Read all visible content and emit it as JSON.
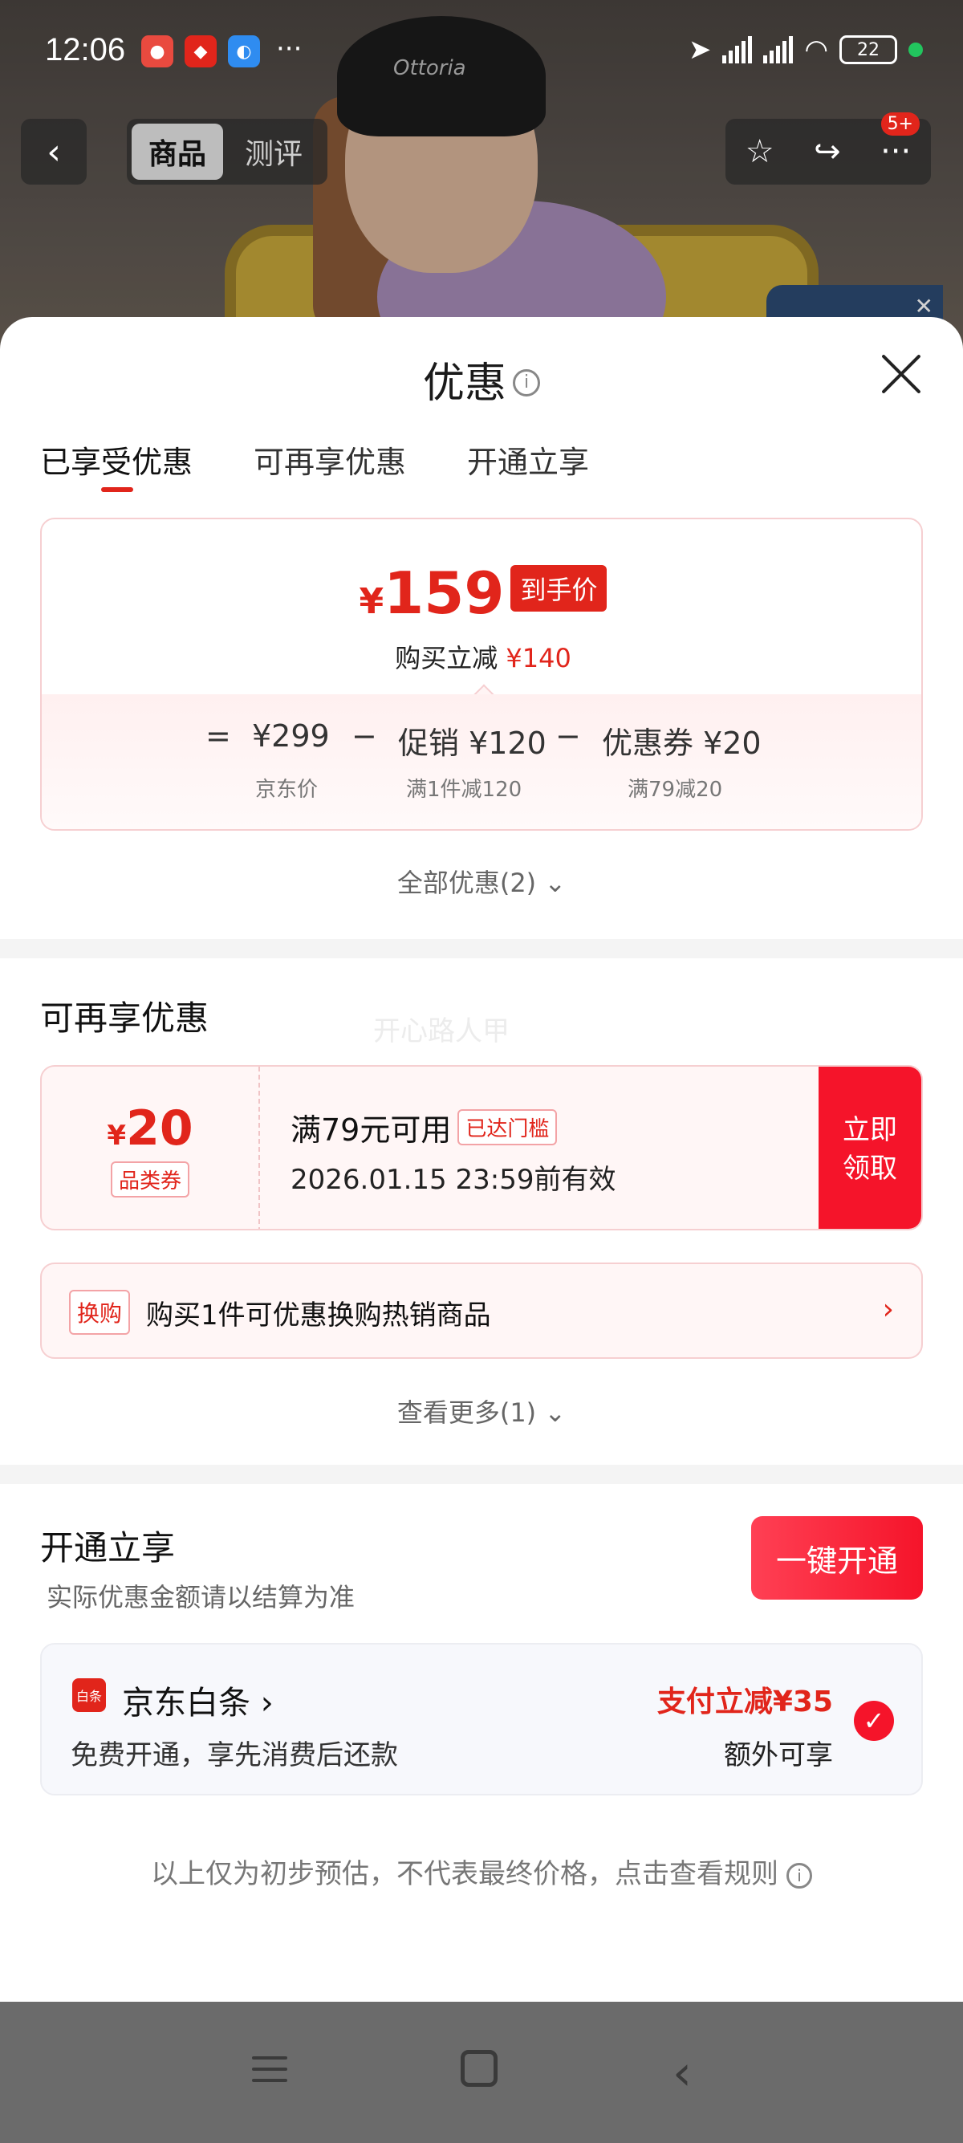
{
  "status_bar": {
    "time": "12:06",
    "battery": "22",
    "app_icons": [
      "app-icon-1",
      "app-icon-2",
      "app-icon-3"
    ],
    "more": "···"
  },
  "nav": {
    "back_glyph": "‹",
    "tabs": [
      "商品",
      "测评"
    ],
    "badge": "5+"
  },
  "sheet": {
    "title": "优惠",
    "tabs": [
      "已享受优惠",
      "可再享优惠",
      "开通立享"
    ],
    "price": {
      "currency": "¥",
      "final": "159",
      "final_tag": "到手价",
      "instant_label": "购买立减",
      "instant_amount": "¥140",
      "eq": "=",
      "jd_price": "¥299",
      "jd_price_label": "京东价",
      "minus1": "−",
      "promo": "促销 ¥120",
      "promo_label": "满1件减120",
      "minus2": "−",
      "coupon": "优惠券 ¥20",
      "coupon_label": "满79减20"
    },
    "all_offers_link": "全部优惠(2) ⌄",
    "more_section": {
      "title": "可再享优惠",
      "watermark": "开心路人甲",
      "coupon": {
        "currency": "¥",
        "amount": "20",
        "kind": "品类券",
        "condition": "满79元可用",
        "reach_tag": "已达门槛",
        "expiry": "2026.01.15 23:59前有效",
        "claim_button": "立即领取"
      },
      "swap": {
        "tag": "换购",
        "text": "购买1件可优惠换购热销商品",
        "arrow": "›"
      },
      "more_link": "查看更多(1) ⌄"
    },
    "open_section": {
      "title": "开通立享",
      "subtitle": "实际优惠金额请以结算为准",
      "button": "一键开通",
      "baitiao": {
        "icon_text": "白条",
        "name": "京东白条 ›",
        "desc": "免费开通，享先消费后还款",
        "saving": "支付立减¥35",
        "extra": "额外可享",
        "check": "✓"
      }
    },
    "disclaimer": "以上仅为初步预估，不代表最终价格，点击查看规则"
  },
  "colors": {
    "accent": "#e1251b",
    "claim_red": "#f5142a"
  }
}
